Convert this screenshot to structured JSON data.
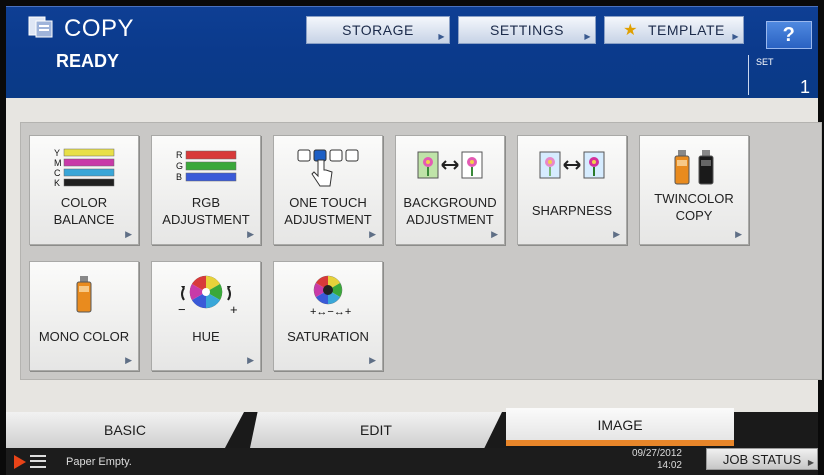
{
  "header": {
    "app_title": "COPY",
    "status": "READY",
    "buttons": {
      "storage": "STORAGE",
      "settings": "SETTINGS",
      "template": "TEMPLATE",
      "help": "?"
    },
    "set_label": "SET",
    "set_value": "1"
  },
  "tiles": [
    {
      "label1": "COLOR",
      "label2": "BALANCE",
      "icon": "color-balance-icon"
    },
    {
      "label1": "RGB",
      "label2": "ADJUSTMENT",
      "icon": "rgb-adjustment-icon"
    },
    {
      "label1": "ONE TOUCH",
      "label2": "ADJUSTMENT",
      "icon": "one-touch-adjustment-icon"
    },
    {
      "label1": "BACKGROUND",
      "label2": "ADJUSTMENT",
      "icon": "background-adjustment-icon"
    },
    {
      "label1": "SHARPNESS",
      "label2": "",
      "icon": "sharpness-icon"
    },
    {
      "label1": "TWINCOLOR",
      "label2": "COPY",
      "icon": "twincolor-copy-icon"
    },
    {
      "label1": "MONO COLOR",
      "label2": "",
      "icon": "mono-color-icon"
    },
    {
      "label1": "HUE",
      "label2": "",
      "icon": "hue-icon"
    },
    {
      "label1": "SATURATION",
      "label2": "",
      "icon": "saturation-icon"
    }
  ],
  "color_bar_letters": {
    "cmyk": [
      "Y",
      "M",
      "C",
      "K"
    ],
    "rgb": [
      "R",
      "G",
      "B"
    ]
  },
  "tabs": {
    "basic": "BASIC",
    "edit": "EDIT",
    "image": "IMAGE",
    "active": "image"
  },
  "footer": {
    "message": "Paper Empty.",
    "date": "09/27/2012",
    "time": "14:02",
    "job_status": "JOB STATUS"
  },
  "colors": {
    "header_blue": "#0b3a8c",
    "active_tab_accent": "#e8862a",
    "alert": "#e94418"
  }
}
